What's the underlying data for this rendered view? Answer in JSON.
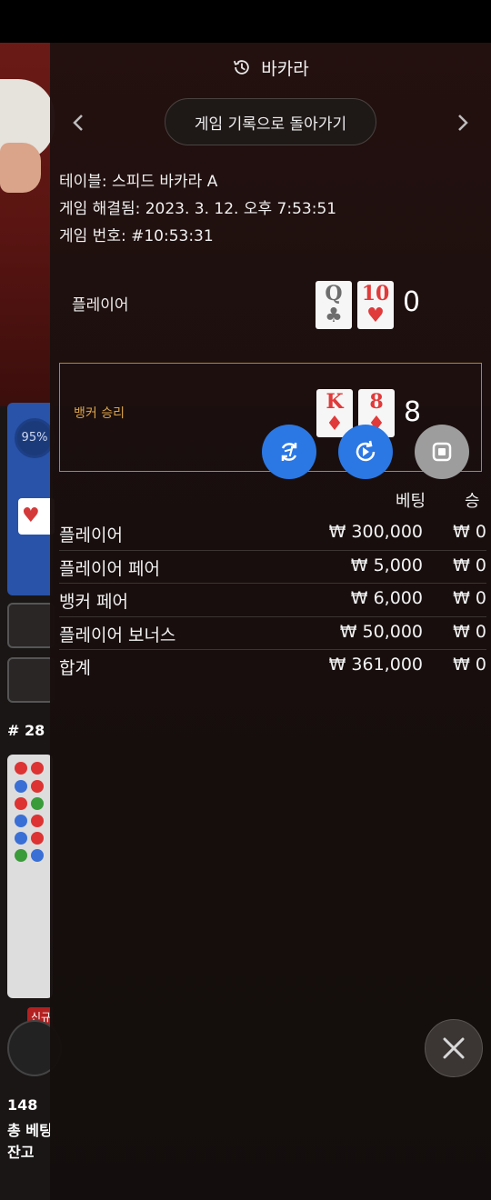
{
  "background": {
    "win_percent": "95%",
    "round_label": "# 28",
    "new_badge": "신규",
    "players_count": "148",
    "total_bet_label": "총 베팅",
    "balance_label": "잔고"
  },
  "panel": {
    "title": "바카라",
    "back_button": "게임 기록으로 돌아가기",
    "table_line": "테이블: 스피드 바카라 A",
    "resolved_line": "게임 해결됨: 2023. 3. 12. 오후 7:53:51",
    "game_number_line": "게임 번호: #10:53:31",
    "player": {
      "label": "플레이어",
      "cards": [
        {
          "rank": "Q",
          "suit": "♣",
          "color": "grey"
        },
        {
          "rank": "10",
          "suit": "♥",
          "color": "red"
        }
      ],
      "score": "0"
    },
    "banker": {
      "label": "뱅커 승리",
      "cards": [
        {
          "rank": "K",
          "suit": "♦",
          "color": "red"
        },
        {
          "rank": "8",
          "suit": "♦",
          "color": "red"
        }
      ],
      "score": "8"
    },
    "bets_header": {
      "bet": "베팅",
      "win": "승"
    },
    "bets": [
      {
        "name": "플레이어",
        "amount": "₩ 300,000",
        "win": "₩ 0"
      },
      {
        "name": "플레이어 페어",
        "amount": "₩ 5,000",
        "win": "₩ 0"
      },
      {
        "name": "뱅커 페어",
        "amount": "₩ 6,000",
        "win": "₩ 0"
      },
      {
        "name": "플레이어 보너스",
        "amount": "₩ 50,000",
        "win": "₩ 0"
      },
      {
        "name": "합계",
        "amount": "₩ 361,000",
        "win": "₩ 0"
      }
    ],
    "colors": {
      "accent_blue": "#2b78e4",
      "banker_gold": "#b28532",
      "card_red": "#e03a3a"
    }
  }
}
